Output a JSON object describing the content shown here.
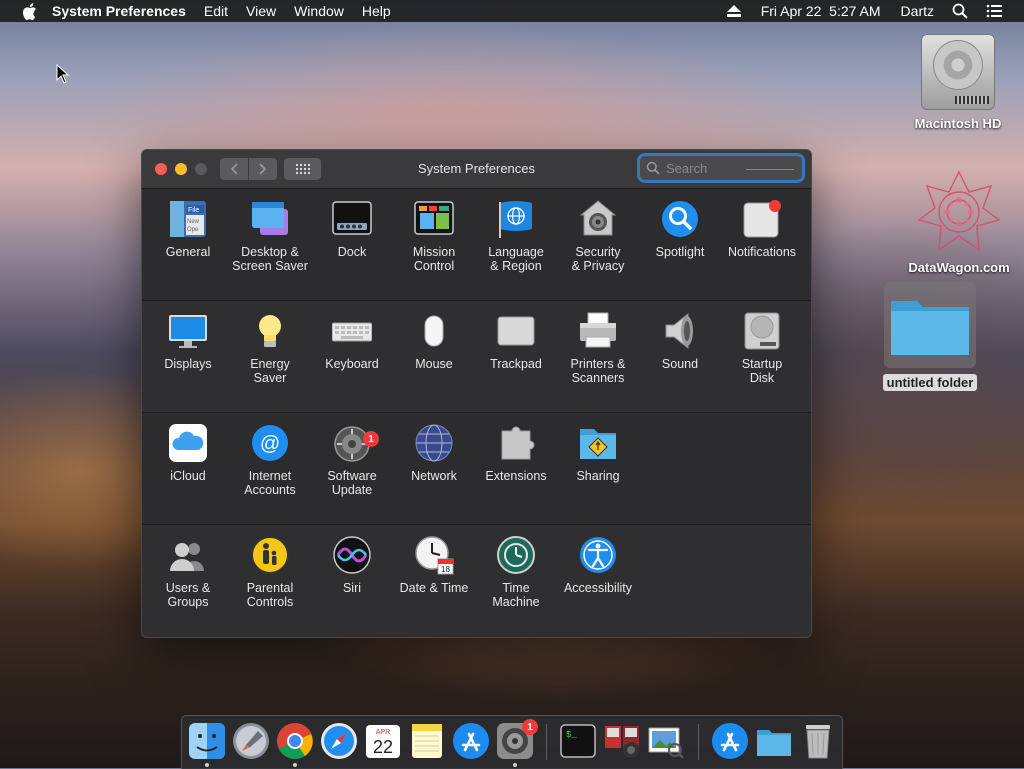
{
  "menubar": {
    "app_name": "System Preferences",
    "menus": [
      "Edit",
      "View",
      "Window",
      "Help"
    ],
    "clock": "Fri Apr 22  5:27 AM",
    "user": "Dartz"
  },
  "desktop": {
    "items": [
      {
        "label": "Macintosh HD"
      },
      {
        "label": "DataWagon.com"
      },
      {
        "label": "untitled folder"
      }
    ]
  },
  "window": {
    "title": "System Preferences",
    "search_placeholder": "Search",
    "rows": [
      [
        {
          "label": "General",
          "icon": "general-icon"
        },
        {
          "label": "Desktop &\nScreen Saver",
          "icon": "desktop-screen-saver-icon"
        },
        {
          "label": "Dock",
          "icon": "dock-icon"
        },
        {
          "label": "Mission\nControl",
          "icon": "mission-control-icon"
        },
        {
          "label": "Language\n& Region",
          "icon": "language-region-icon"
        },
        {
          "label": "Security\n& Privacy",
          "icon": "security-privacy-icon"
        },
        {
          "label": "Spotlight",
          "icon": "spotlight-icon"
        },
        {
          "label": "Notifications",
          "icon": "notifications-icon"
        }
      ],
      [
        {
          "label": "Displays",
          "icon": "displays-icon"
        },
        {
          "label": "Energy\nSaver",
          "icon": "energy-saver-icon"
        },
        {
          "label": "Keyboard",
          "icon": "keyboard-icon"
        },
        {
          "label": "Mouse",
          "icon": "mouse-icon"
        },
        {
          "label": "Trackpad",
          "icon": "trackpad-icon"
        },
        {
          "label": "Printers &\nScanners",
          "icon": "printers-scanners-icon"
        },
        {
          "label": "Sound",
          "icon": "sound-icon"
        },
        {
          "label": "Startup\nDisk",
          "icon": "startup-disk-icon"
        }
      ],
      [
        {
          "label": "iCloud",
          "icon": "icloud-icon"
        },
        {
          "label": "Internet\nAccounts",
          "icon": "internet-accounts-icon"
        },
        {
          "label": "Software\nUpdate",
          "icon": "software-update-icon",
          "badge": "1"
        },
        {
          "label": "Network",
          "icon": "network-icon"
        },
        {
          "label": "Extensions",
          "icon": "extensions-icon"
        },
        {
          "label": "Sharing",
          "icon": "sharing-icon"
        }
      ],
      [
        {
          "label": "Users &\nGroups",
          "icon": "users-groups-icon"
        },
        {
          "label": "Parental\nControls",
          "icon": "parental-controls-icon"
        },
        {
          "label": "Siri",
          "icon": "siri-icon"
        },
        {
          "label": "Date & Time",
          "icon": "date-time-icon"
        },
        {
          "label": "Time\nMachine",
          "icon": "time-machine-icon"
        },
        {
          "label": "Accessibility",
          "icon": "accessibility-icon"
        }
      ]
    ]
  },
  "dock": {
    "calendar_month": "APR",
    "calendar_day": "22",
    "software_update_badge": "1",
    "items": [
      "finder-icon",
      "launchpad-icon",
      "chrome-icon",
      "safari-icon",
      "calendar-icon",
      "notes-icon",
      "app-store-icon",
      "system-preferences-icon",
      "terminal-icon",
      "photo-booth-icon",
      "preview-icon",
      "app-store-folder-icon",
      "folder-icon",
      "trash-icon"
    ]
  },
  "colors": {
    "window_bg": "#2c2c2e",
    "accent": "#3682d2",
    "close": "#fc5f57",
    "minimize": "#fdbc2e",
    "badge": "#f13b3b"
  }
}
